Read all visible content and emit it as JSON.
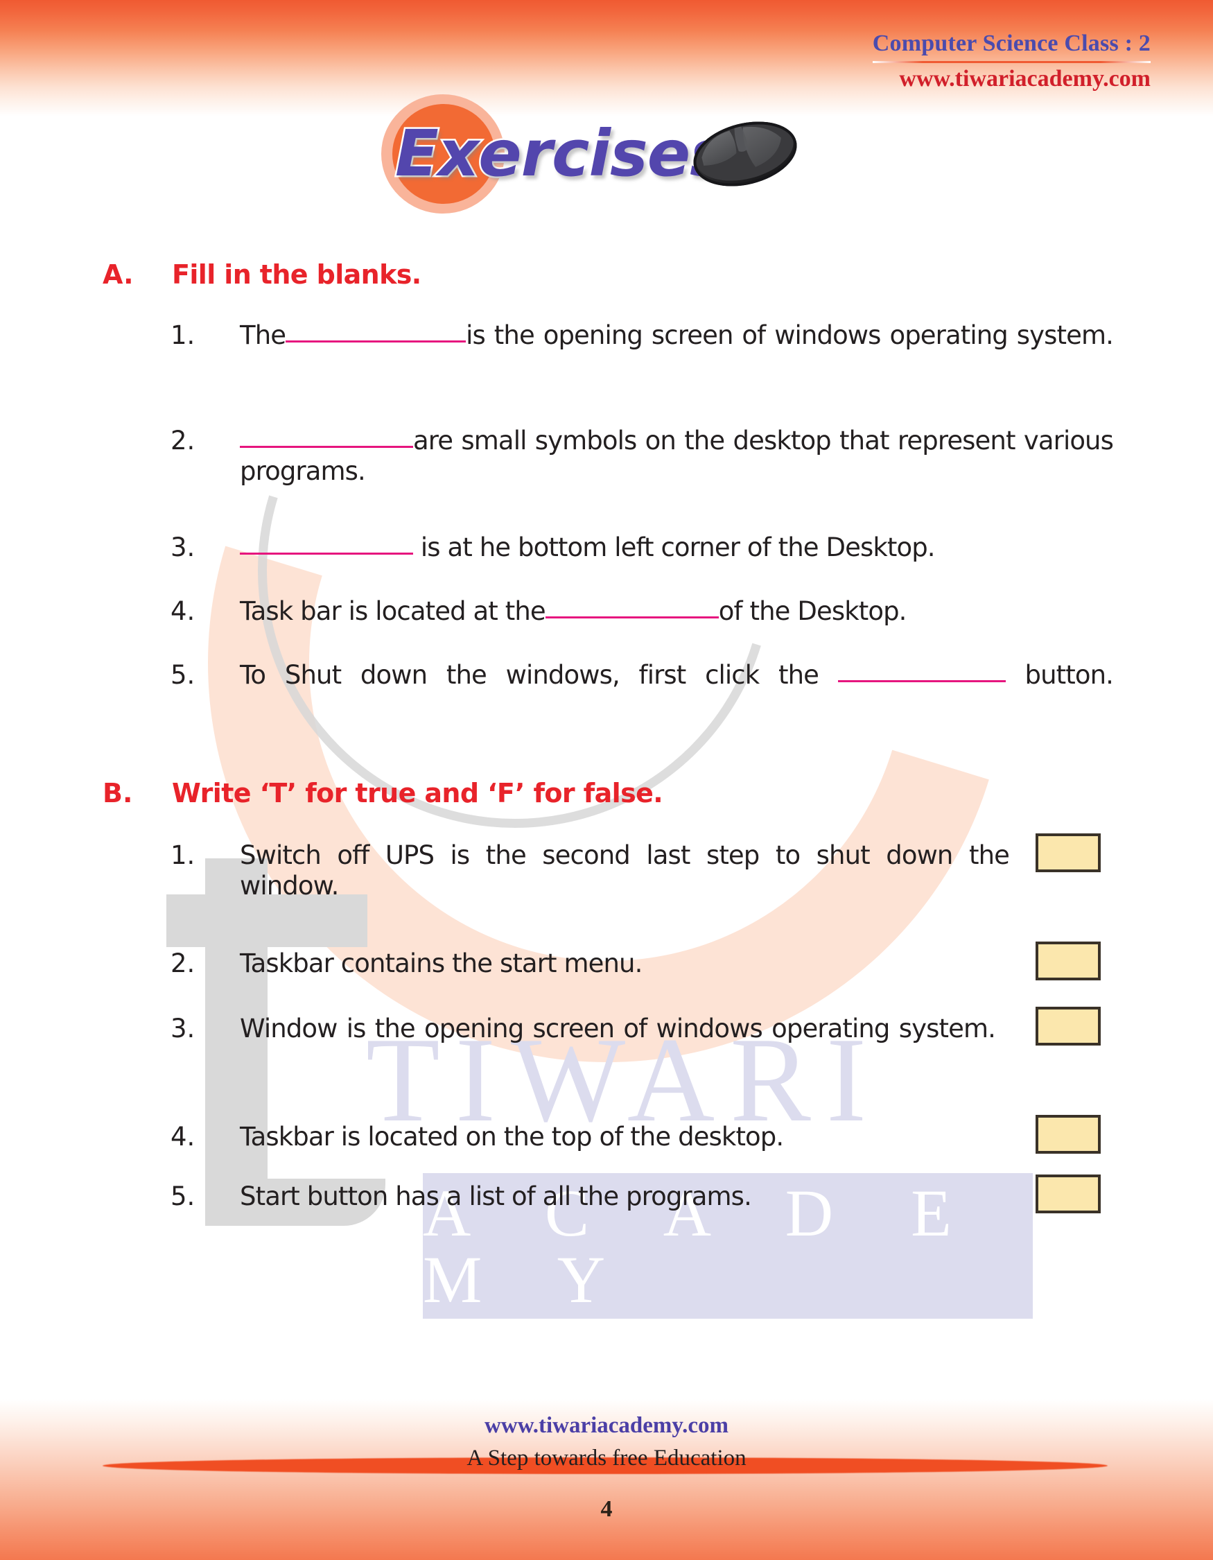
{
  "header": {
    "title": "Computer Science Class : 2",
    "website": "www.tiwariacademy.com"
  },
  "hero": {
    "title": "Exercises",
    "icon": "computer-mouse"
  },
  "watermark": {
    "letter": "t",
    "line1": "TIWARI",
    "line2": "A C A D E M Y"
  },
  "sections": [
    {
      "letter": "A.",
      "heading": "Fill in the blanks.",
      "items": [
        {
          "num": "1.",
          "pre": "The",
          "blank_width": 260,
          "post": "is  the  opening  screen  of  windows operating system.",
          "justify": true
        },
        {
          "num": "2.",
          "pre": "",
          "blank_width": 250,
          "post": "are  small  symbols  on  the  desktop  that represent various programs.",
          "justify": true
        },
        {
          "num": "3.",
          "pre": "",
          "blank_width": 250,
          "post": " is at he bottom left corner of the Desktop.",
          "justify": false
        },
        {
          "num": "4.",
          "pre": "Task bar is located at the",
          "blank_width": 250,
          "post": "of the Desktop.",
          "justify": false
        },
        {
          "num": "5.",
          "pre": "To  Shut  down  the  windows,  first  click  the  ",
          "blank_width": 242,
          "post": " button.",
          "justify": true
        }
      ]
    },
    {
      "letter": "B.",
      "heading": "Write ‘T’ for true and ‘F’ for false.",
      "items": [
        {
          "num": "1.",
          "text": "Switch off UPS is the second last step to shut down the window.",
          "justify": true,
          "box": true
        },
        {
          "num": "2.",
          "text": " Taskbar contains the start menu.",
          "justify": false,
          "box": true
        },
        {
          "num": "3.",
          "text": "Window  is  the  opening  screen  of  windows  operating system.",
          "justify": true,
          "box": true
        },
        {
          "num": "4.",
          "text": "Taskbar is located on the top of the desktop.",
          "justify": false,
          "box": true
        },
        {
          "num": "5.",
          "text": "Start button has a list of all the programs.",
          "justify": false,
          "box": true
        }
      ]
    }
  ],
  "footer": {
    "website": "www.tiwariacademy.com",
    "tagline": "A Step towards free Education",
    "page_number": "4"
  },
  "colors": {
    "band_orange": "#f05a32",
    "heading_red": "#e8232a",
    "blank_pink": "#e6157e",
    "hero_purple": "#5346ad",
    "header_blue": "#4b4bad",
    "header_red": "#d11f2a",
    "answer_box_fill": "#fbe7ad",
    "answer_box_border": "#3a3228"
  }
}
